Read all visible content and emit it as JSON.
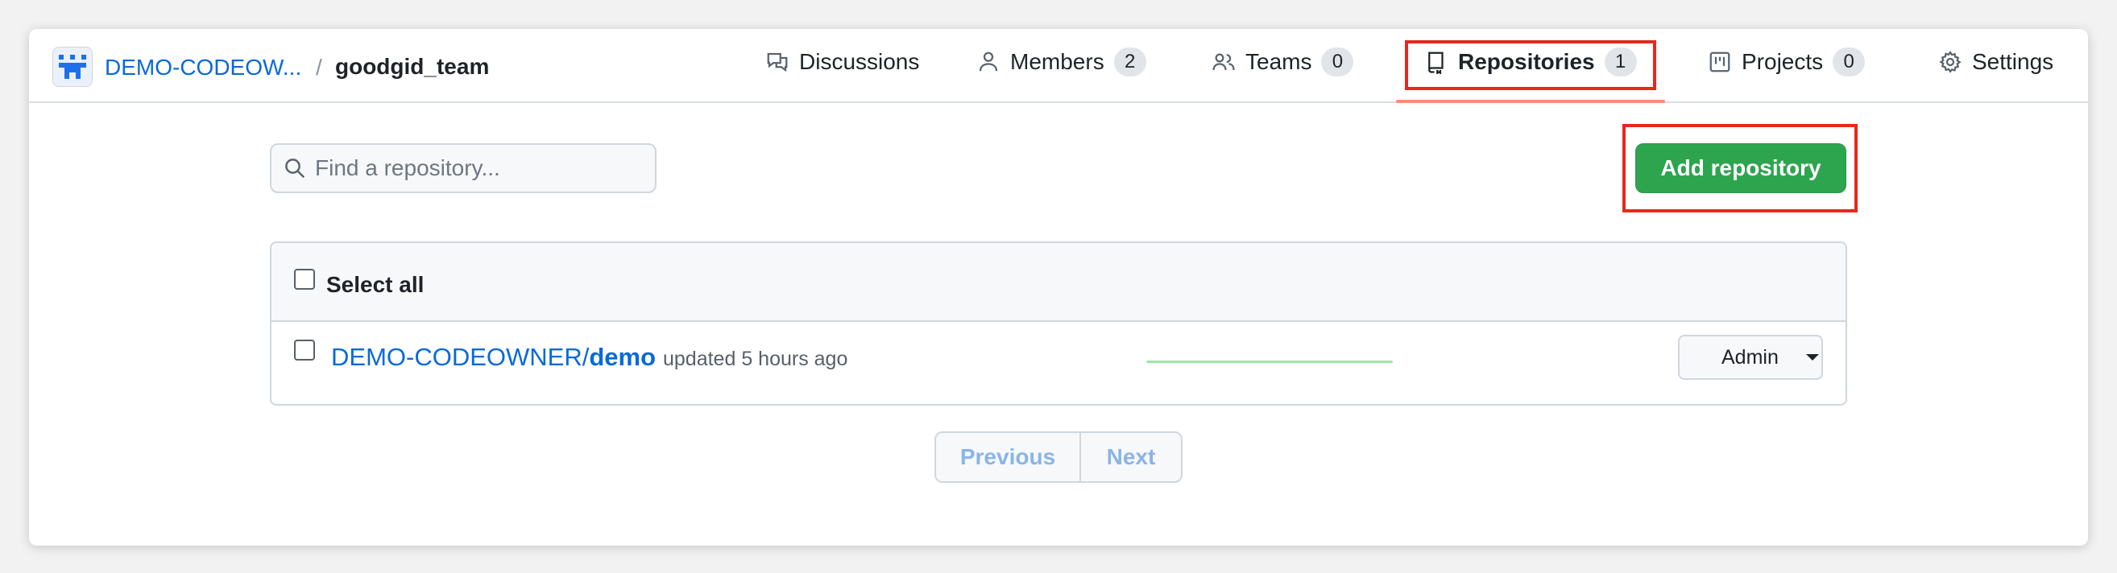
{
  "breadcrumb": {
    "org": "DEMO-CODEOW...",
    "separator": "/",
    "team": "goodgid_team"
  },
  "tabs": [
    {
      "label": "Discussions",
      "icon": "comment-discussion-icon",
      "count": null
    },
    {
      "label": "Members",
      "icon": "person-icon",
      "count": "2"
    },
    {
      "label": "Teams",
      "icon": "people-icon",
      "count": "0"
    },
    {
      "label": "Repositories",
      "icon": "repo-icon",
      "count": "1",
      "selected": true
    },
    {
      "label": "Projects",
      "icon": "project-icon",
      "count": "0"
    },
    {
      "label": "Settings",
      "icon": "gear-icon",
      "count": null
    }
  ],
  "toolbar": {
    "search_placeholder": "Find a repository...",
    "add_button_label": "Add repository"
  },
  "list": {
    "select_all_label": "Select all",
    "rows": [
      {
        "owner": "DEMO-CODEOWNER/",
        "name": "demo",
        "updated": "updated 5 hours ago",
        "role": "Admin"
      }
    ]
  },
  "pagination": {
    "previous_label": "Previous",
    "next_label": "Next"
  },
  "colors": {
    "accent_link": "#0969da",
    "primary_button": "#2da44e",
    "highlight_box": "#e8271d",
    "selected_tab_underline": "#fd8c73"
  }
}
